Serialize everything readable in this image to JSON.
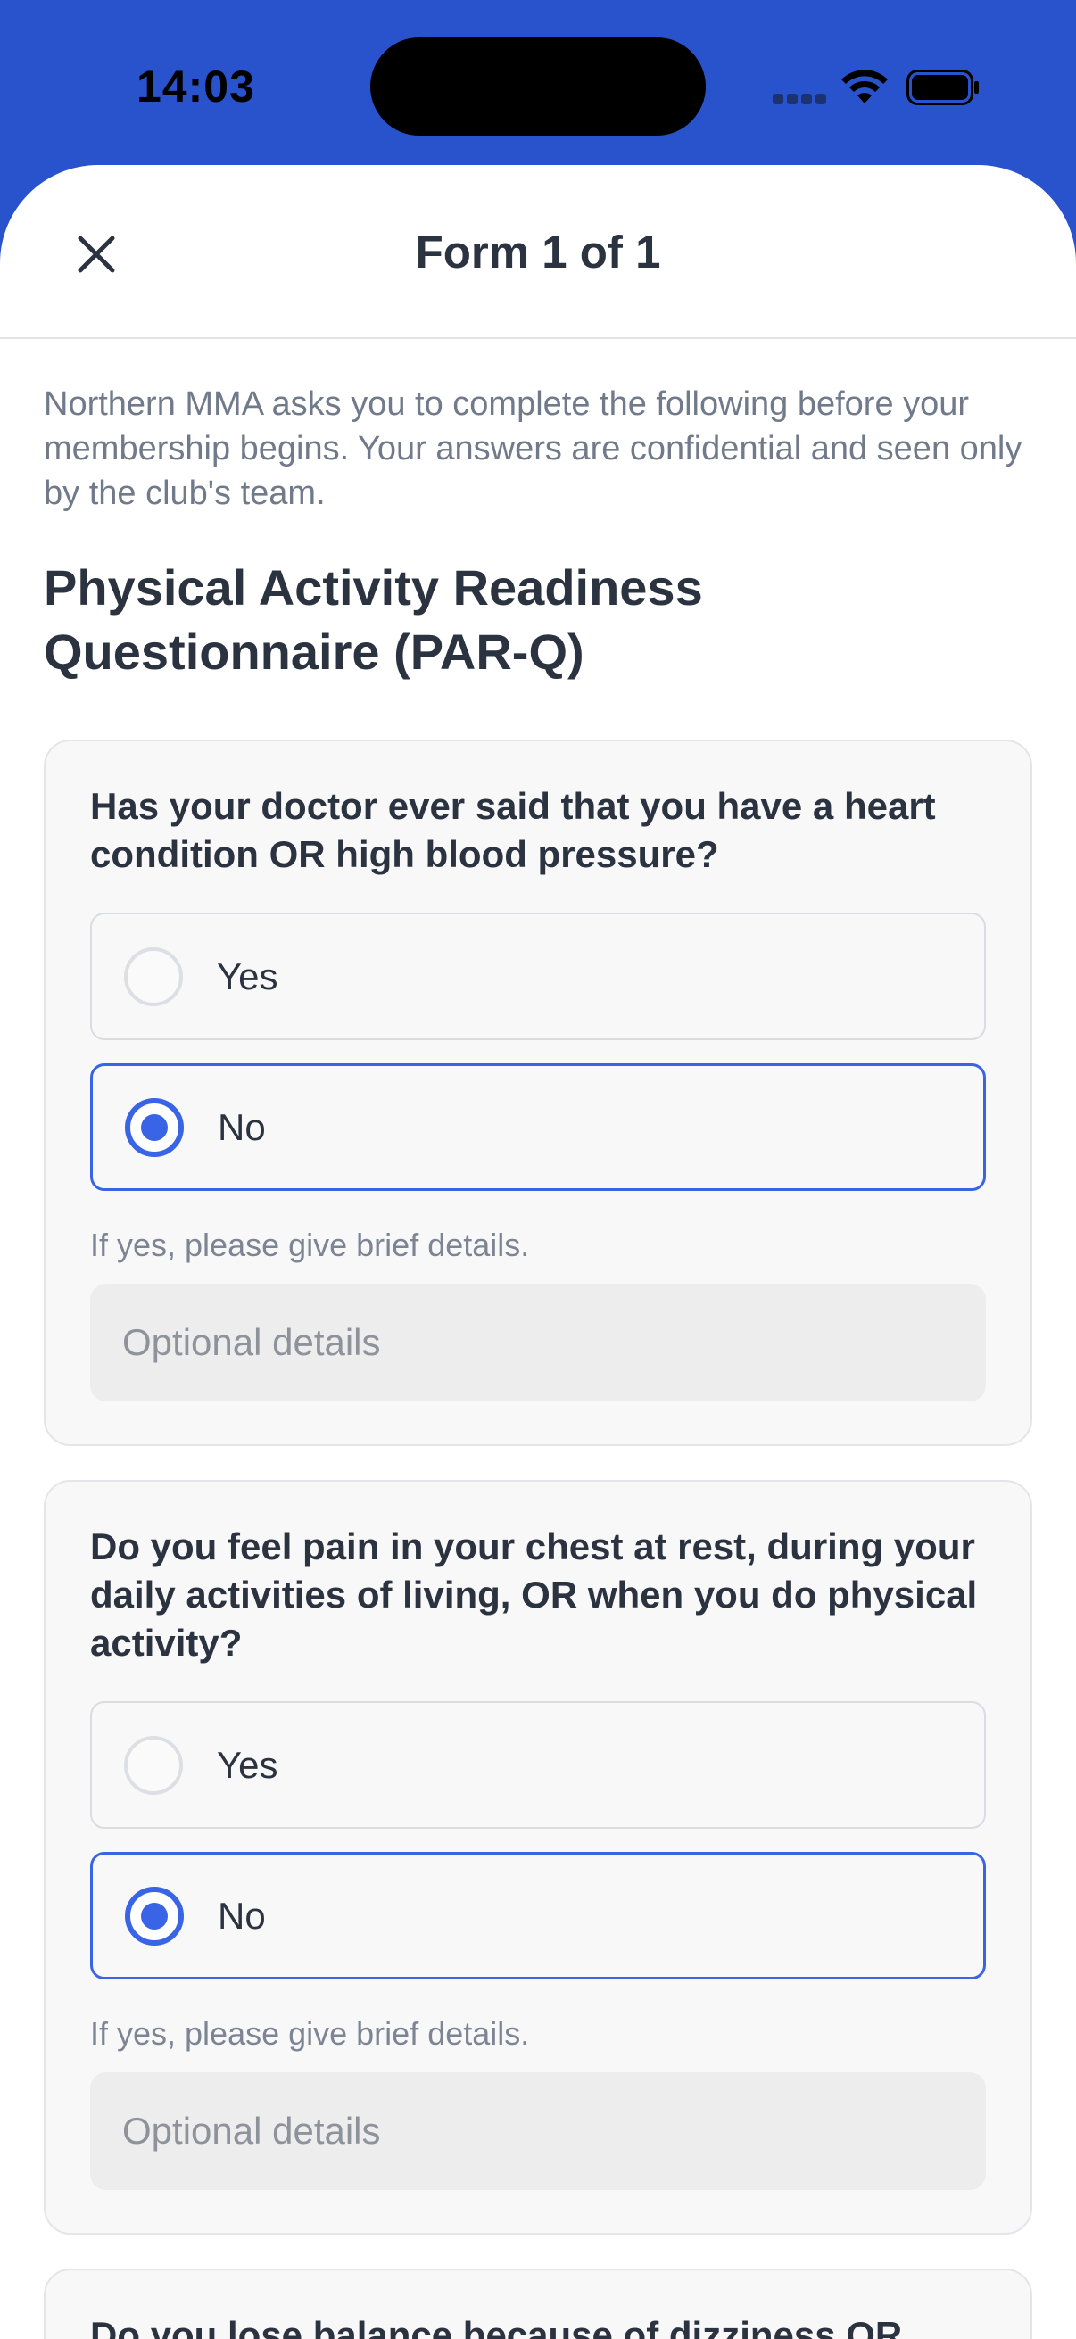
{
  "status_bar": {
    "time": "14:03"
  },
  "header": {
    "title": "Form 1 of 1"
  },
  "intro": "Northern MMA asks you to complete the following before your membership begins. Your answers are confidential and seen only by the club's team.",
  "section_title": "Physical Activity Readiness Questionnaire (PAR-Q)",
  "questions": [
    {
      "question": "Has your doctor ever said that you have a heart condition OR high blood pressure?",
      "options": [
        {
          "label": "Yes",
          "selected": false
        },
        {
          "label": "No",
          "selected": true
        }
      ],
      "hint": "If yes, please give brief details.",
      "details_placeholder": "Optional details"
    },
    {
      "question": "Do you feel pain in your chest at rest, during your daily activities of living, OR when you do physical activity?",
      "options": [
        {
          "label": "Yes",
          "selected": false
        },
        {
          "label": "No",
          "selected": true
        }
      ],
      "hint": "If yes, please give brief details.",
      "details_placeholder": "Optional details"
    },
    {
      "question": "Do you lose balance because of dizziness OR"
    }
  ],
  "colors": {
    "brand_blue": "#2953cc",
    "accent": "#3a64e6"
  }
}
